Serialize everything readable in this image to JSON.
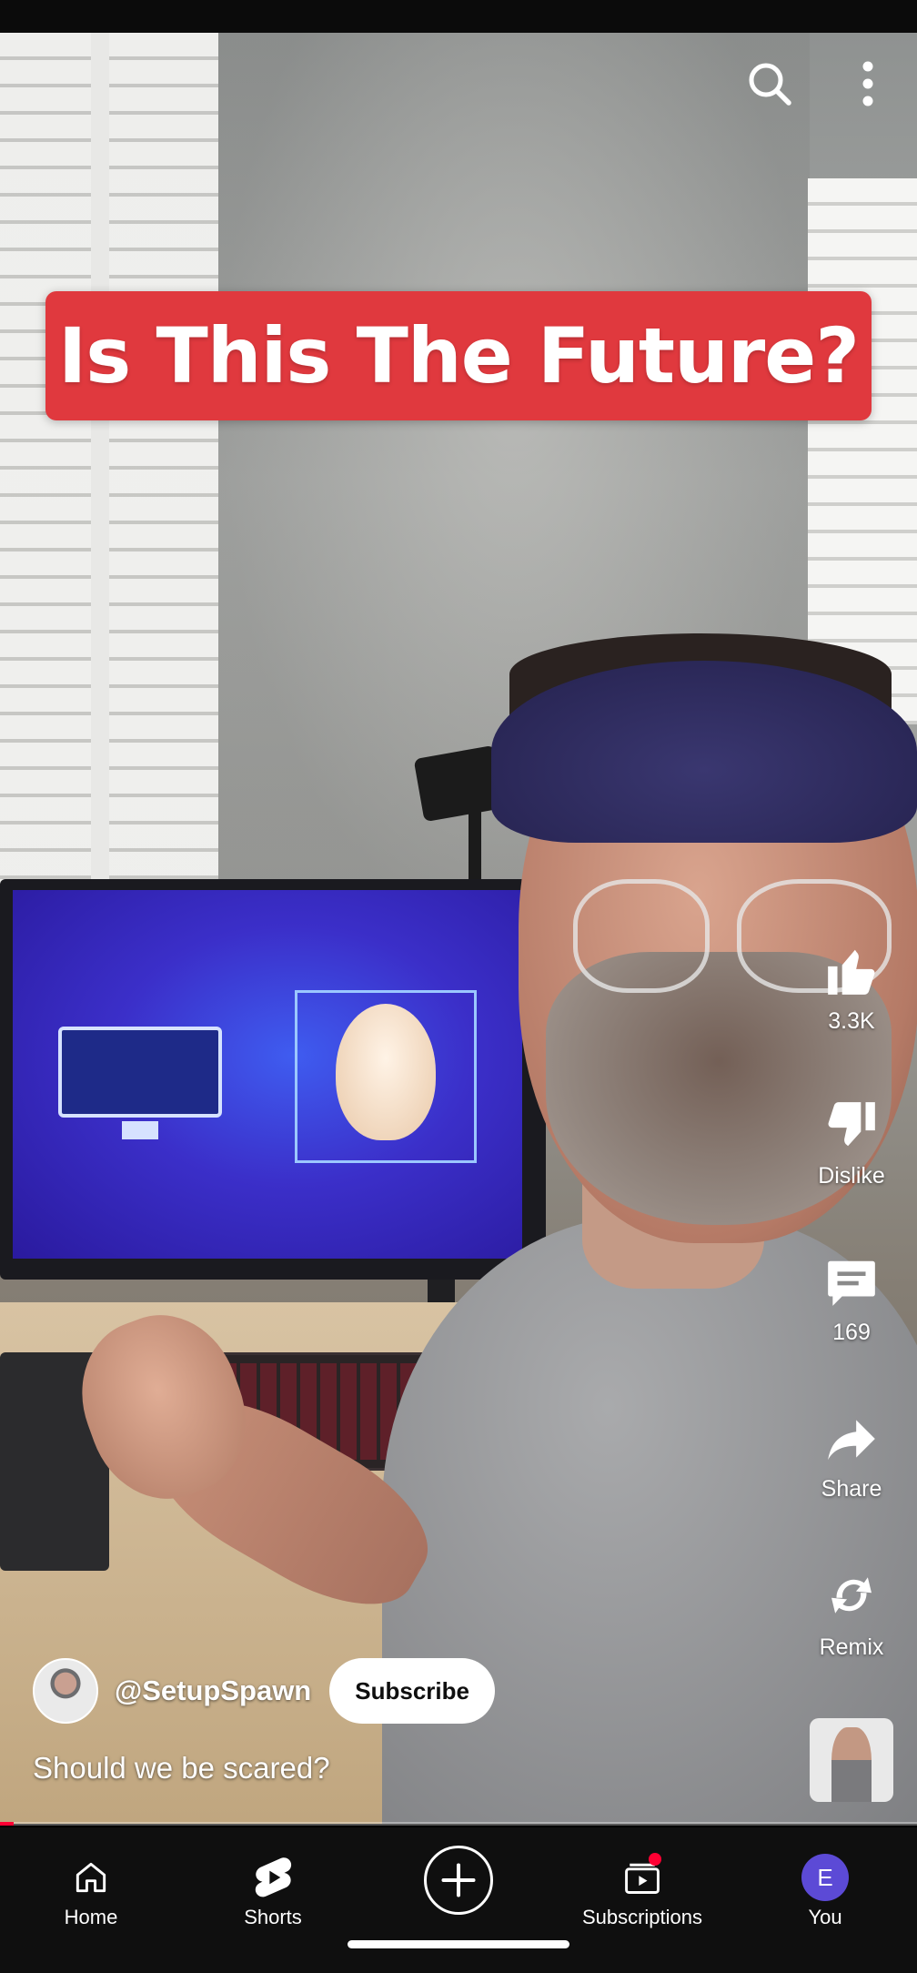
{
  "video": {
    "title_banner": "Is This The Future?",
    "caption": "Should we be scared?",
    "progress_fraction": 0.015
  },
  "top_icons": [
    "search-icon",
    "more-vert-icon"
  ],
  "actions": {
    "like_count": "3.3K",
    "dislike_label": "Dislike",
    "comment_count": "169",
    "share_label": "Share",
    "remix_label": "Remix"
  },
  "channel": {
    "handle": "@SetupSpawn",
    "subscribe_label": "Subscribe"
  },
  "nav": {
    "items": [
      {
        "label": "Home",
        "icon": "home-icon"
      },
      {
        "label": "Shorts",
        "icon": "shorts-icon"
      },
      {
        "label": "",
        "icon": "create-icon"
      },
      {
        "label": "Subscriptions",
        "icon": "subscriptions-icon"
      },
      {
        "label": "You",
        "icon": "you-avatar"
      }
    ],
    "you_initial": "E"
  },
  "colors": {
    "banner_red": "#e0393e",
    "progress_red": "#ff0033",
    "nav_bg": "#0f0f0f",
    "you_avatar": "#5c4ad6"
  }
}
